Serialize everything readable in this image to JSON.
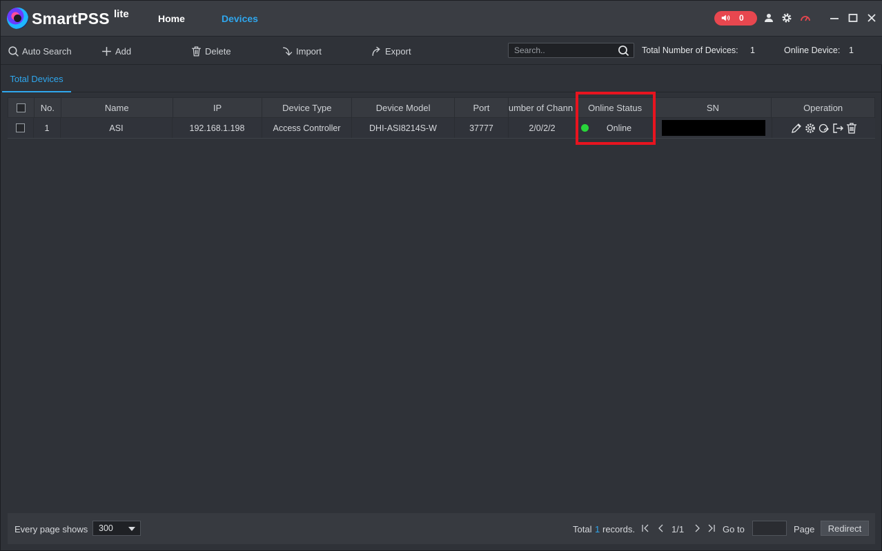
{
  "app": {
    "brand": "SmartPSS",
    "brand_sup": "lite",
    "nav": {
      "home": "Home",
      "devices": "Devices"
    },
    "alarm_count": "0"
  },
  "toolbar": {
    "auto_search": "Auto Search",
    "add": "Add",
    "delete": "Delete",
    "import": "Import",
    "export": "Export",
    "search_placeholder": "Search..",
    "total_label": "Total Number of Devices:",
    "total_value": "1",
    "online_label": "Online Device:",
    "online_value": "1"
  },
  "tabs": {
    "active": "Total Devices"
  },
  "table": {
    "headers": {
      "no": "No.",
      "name": "Name",
      "ip": "IP",
      "type": "Device Type",
      "model": "Device Model",
      "port": "Port",
      "channels": "umber of Chann",
      "status": "Online Status",
      "sn": "SN",
      "operation": "Operation"
    },
    "rows": [
      {
        "no": "1",
        "name": "ASI",
        "ip": "192.168.1.198",
        "type": "Access Controller",
        "model": "DHI-ASI8214S-W",
        "port": "37777",
        "channels": "2/0/2/2",
        "status": "Online"
      }
    ]
  },
  "footer": {
    "page_shows_label": "Every page shows",
    "page_size": "300",
    "total_prefix": "Total",
    "total_count": "1",
    "total_suffix": "records.",
    "page_indicator": "1/1",
    "goto_label": "Go to",
    "page_label": "Page",
    "redirect": "Redirect"
  },
  "colors": {
    "accent": "#2fa7ee",
    "online": "#28d53a",
    "alarm": "#e8474f",
    "highlight": "#e8141f"
  }
}
